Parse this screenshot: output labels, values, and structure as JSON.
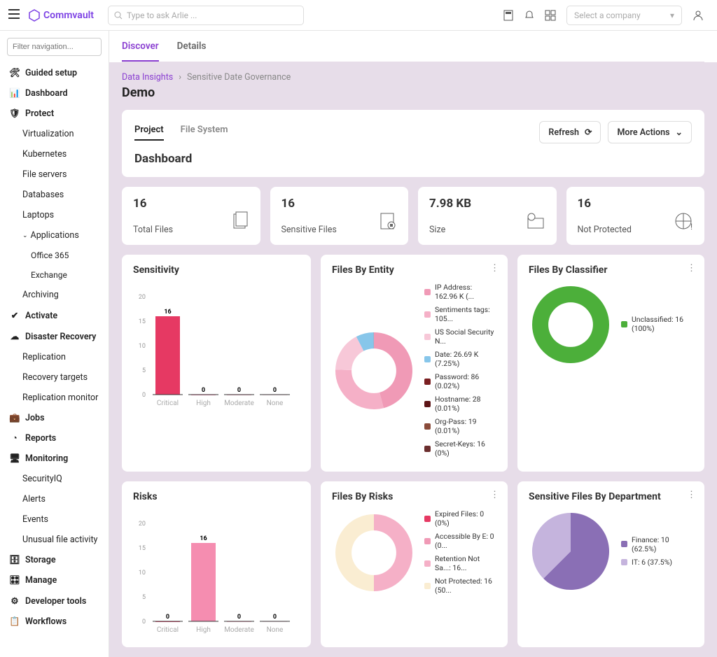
{
  "topbar": {
    "brand": "Commvault",
    "search_placeholder": "Type to ask Arlie ...",
    "company_placeholder": "Select a company"
  },
  "sidebar": {
    "filter_placeholder": "Filter navigation...",
    "items": {
      "guided": "Guided setup",
      "dashboard": "Dashboard",
      "protect": "Protect",
      "virtualization": "Virtualization",
      "kubernetes": "Kubernetes",
      "fileservers": "File servers",
      "databases": "Databases",
      "laptops": "Laptops",
      "applications": "Applications",
      "office365": "Office 365",
      "exchange": "Exchange",
      "archiving": "Archiving",
      "activate": "Activate",
      "disaster": "Disaster Recovery",
      "replication": "Replication",
      "recoverytargets": "Recovery targets",
      "replicationmonitor": "Replication monitor",
      "jobs": "Jobs",
      "reports": "Reports",
      "monitoring": "Monitoring",
      "securityiq": "SecurityIQ",
      "alerts": "Alerts",
      "events": "Events",
      "unusual": "Unusual file activity",
      "storage": "Storage",
      "manage": "Manage",
      "devtools": "Developer tools",
      "workflows": "Workflows"
    }
  },
  "header": {
    "tab_discover": "Discover",
    "tab_details": "Details",
    "bc1": "Data Insights",
    "bc2": "Sensitive Date Governance",
    "title": "Demo"
  },
  "panel": {
    "tab_project": "Project",
    "tab_filesystem": "File System",
    "refresh": "Refresh",
    "more_actions": "More Actions",
    "dash_title": "Dashboard"
  },
  "stats": {
    "total_files": {
      "value": "16",
      "label": "Total Files"
    },
    "sensitive_files": {
      "value": "16",
      "label": "Sensitive Files"
    },
    "size": {
      "value": "7.98 KB",
      "label": "Size"
    },
    "not_protected": {
      "value": "16",
      "label": "Not Protected"
    }
  },
  "chart_data": [
    {
      "type": "bar",
      "title": "Sensitivity",
      "categories": [
        "Critical",
        "High",
        "Moderate",
        "None"
      ],
      "values": [
        16,
        0,
        0,
        0
      ],
      "ylim": [
        0,
        20
      ],
      "colors": [
        "#e63963",
        "#f58db0",
        "#f5b0c7",
        "#fbe0eb"
      ]
    },
    {
      "type": "donut",
      "title": "Files By Entity",
      "series": [
        {
          "name": "IP Address: 162.96 K (...",
          "value": 162960,
          "color": "#f09ab6"
        },
        {
          "name": "Sentiments tags: 105...",
          "value": 105000,
          "color": "#f5b0c7"
        },
        {
          "name": "US Social Security N...",
          "value": 60000,
          "color": "#f7c8d8"
        },
        {
          "name": "Date: 26.69 K (7.25%)",
          "value": 26690,
          "color": "#87c6ea"
        },
        {
          "name": "Password: 86 (0.02%)",
          "value": 86,
          "color": "#7a1f21"
        },
        {
          "name": "Hostname: 28 (0.01%)",
          "value": 28,
          "color": "#5c1416"
        },
        {
          "name": "Org-Pass: 19 (0.01%)",
          "value": 19,
          "color": "#8a4b3a"
        },
        {
          "name": "Secret-Keys: 16 (0%)",
          "value": 16,
          "color": "#6b2e2e"
        }
      ]
    },
    {
      "type": "donut",
      "title": "Files By Classifier",
      "series": [
        {
          "name": "Unclassified: 16 (100%)",
          "value": 16,
          "color": "#4caf3a"
        }
      ]
    },
    {
      "type": "bar",
      "title": "Risks",
      "categories": [
        "Critical",
        "High",
        "Moderate",
        "None"
      ],
      "values": [
        0,
        16,
        0,
        0
      ],
      "ylim": [
        0,
        20
      ],
      "colors": [
        "#e63963",
        "#f58db0",
        "#f5b0c7",
        "#fbe0eb"
      ]
    },
    {
      "type": "donut",
      "title": "Files By Risks",
      "series": [
        {
          "name": "Expired Files: 0 (0%)",
          "value": 0,
          "color": "#e63963"
        },
        {
          "name": "Accessible By E: 0 (0...",
          "value": 0,
          "color": "#f09ab6"
        },
        {
          "name": "Retention Not Sa...: 16...",
          "value": 16,
          "color": "#f5b0c7"
        },
        {
          "name": "Not Protected: 16 (50...",
          "value": 16,
          "color": "#faedd2"
        }
      ]
    },
    {
      "type": "pie",
      "title": "Sensitive Files By Department",
      "series": [
        {
          "name": "Finance: 10 (62.5%)",
          "value": 10,
          "color": "#8a6fb5"
        },
        {
          "name": "IT: 6 (37.5%)",
          "value": 6,
          "color": "#c5b4dd"
        }
      ]
    }
  ]
}
